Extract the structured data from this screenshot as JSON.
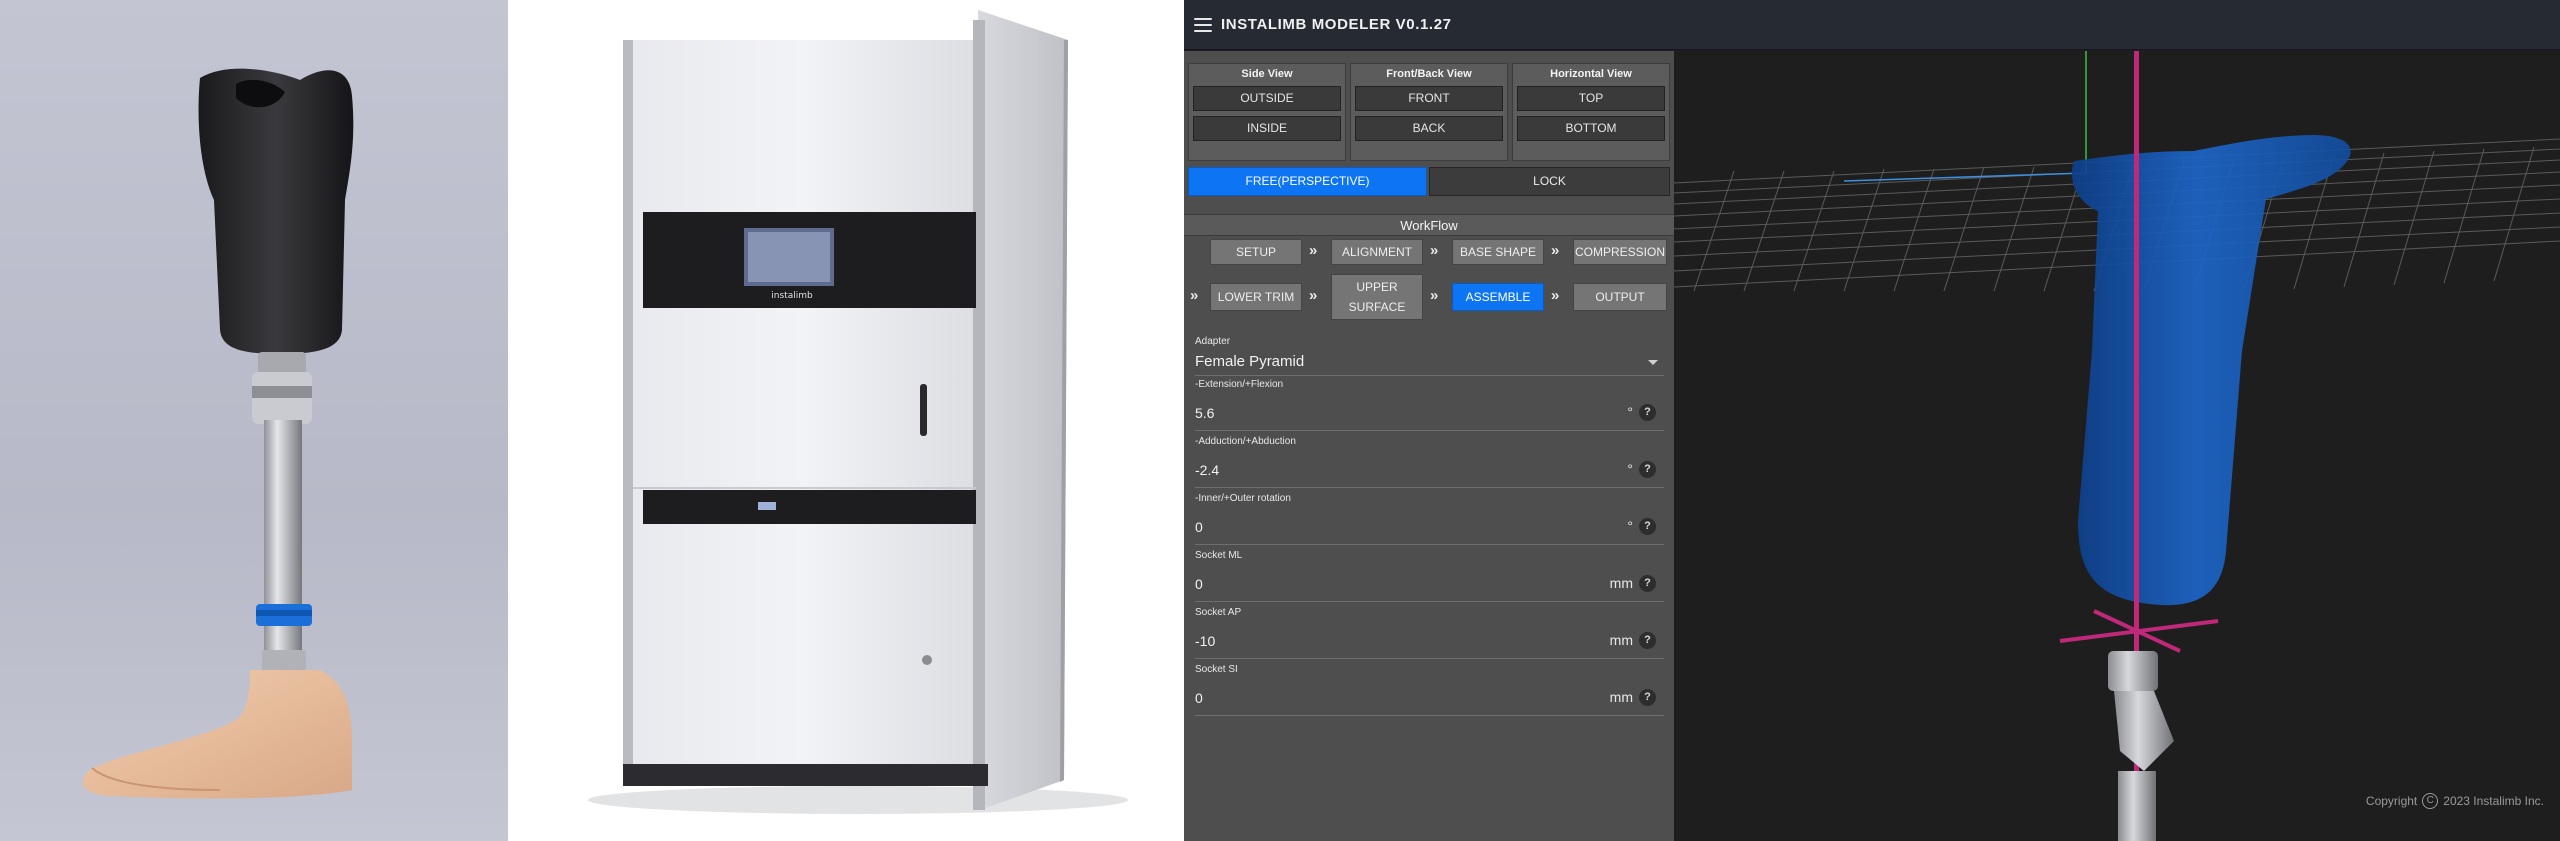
{
  "app": {
    "title": "INSTALIMB MODELER V0.1.27"
  },
  "view_groups": [
    {
      "title": "Side View",
      "buttons": [
        "OUTSIDE",
        "INSIDE"
      ]
    },
    {
      "title": "Front/Back View",
      "buttons": [
        "FRONT",
        "BACK"
      ]
    },
    {
      "title": "Horizontal View",
      "buttons": [
        "TOP",
        "BOTTOM"
      ]
    }
  ],
  "camera": {
    "free_label": "FREE(PERSPECTIVE)",
    "lock_label": "LOCK",
    "active": "free"
  },
  "workflow": {
    "title": "WorkFlow",
    "row1": [
      "SETUP",
      "ALIGNMENT",
      "BASE SHAPE",
      "COMPRESSION"
    ],
    "row2": [
      "LOWER TRIM",
      "UPPER SURFACE",
      "ASSEMBLE",
      "OUTPUT"
    ],
    "active": "ASSEMBLE",
    "separator": "»"
  },
  "adapter": {
    "label": "Adapter",
    "value": "Female Pyramid"
  },
  "fields": [
    {
      "label": "-Extension/+Flexion",
      "value": "5.6",
      "unit": "°"
    },
    {
      "label": "-Adduction/+Abduction",
      "value": "-2.4",
      "unit": "°"
    },
    {
      "label": "-Inner/+Outer rotation",
      "value": "0",
      "unit": "°"
    },
    {
      "label": "Socket ML",
      "value": "0",
      "unit": "mm"
    },
    {
      "label": "Socket AP",
      "value": "-10",
      "unit": "mm"
    },
    {
      "label": "Socket SI",
      "value": "0",
      "unit": "mm"
    }
  ],
  "help_glyph": "?",
  "printer_brand": "instalimb",
  "footer": {
    "copyright_label": "Copyright",
    "copyright_symbol": "C",
    "copyright_text": "2023 Instalimb Inc."
  },
  "colors": {
    "accent_blue": "#0d75f4",
    "socket_blue": "#1659b8",
    "axis_magenta": "#c0297a",
    "axis_green": "#3cc23c",
    "axis_blue": "#3d8fe0"
  }
}
